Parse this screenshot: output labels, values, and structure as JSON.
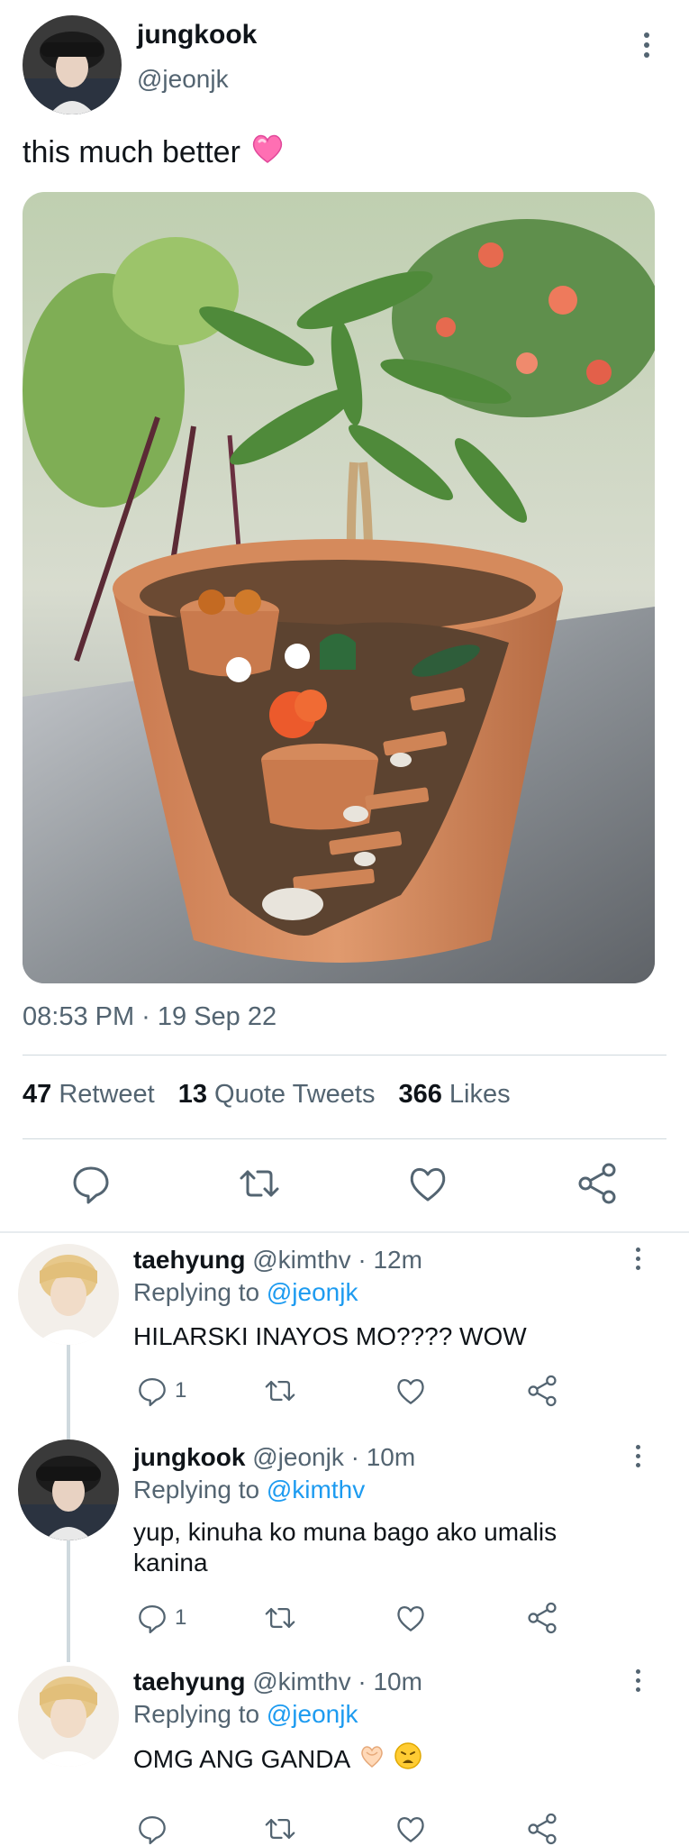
{
  "tweet": {
    "author_name": "jungkook",
    "author_handle": "@jeonjk",
    "text": "this much better",
    "emoji": "heart-emoji",
    "timestamp": "08:53 PM · 19 Sep 22",
    "stats": {
      "retweets_count": "47",
      "retweets_label": "Retweet",
      "quotes_count": "13",
      "quotes_label": "Quote Tweets",
      "likes_count": "366",
      "likes_label": "Likes"
    },
    "image": "photo of a broken terracotta pot fairy garden with small plants and stairs"
  },
  "replies": [
    {
      "name": "taehyung",
      "handle": "@kimthv · 12m",
      "replying_label": "Replying to",
      "replying_to": "@jeonjk",
      "text": "HILARSKI INAYOS MO???? WOW",
      "reply_count": "1"
    },
    {
      "name": "jungkook",
      "handle": "@jeonjk · 10m",
      "replying_label": "Replying to",
      "replying_to": "@kimthv",
      "text": "yup, kinuha ko muna bago ako umalis kanina",
      "reply_count": "1"
    },
    {
      "name": "taehyung",
      "handle": "@kimthv · 10m",
      "replying_label": "Replying to",
      "replying_to": "@jeonjk",
      "text": "OMG ANG GANDA",
      "reply_count": ""
    }
  ],
  "colors": {
    "accent": "#1d9bf0",
    "secondary_text": "#536471",
    "divider": "#cfd9de"
  }
}
